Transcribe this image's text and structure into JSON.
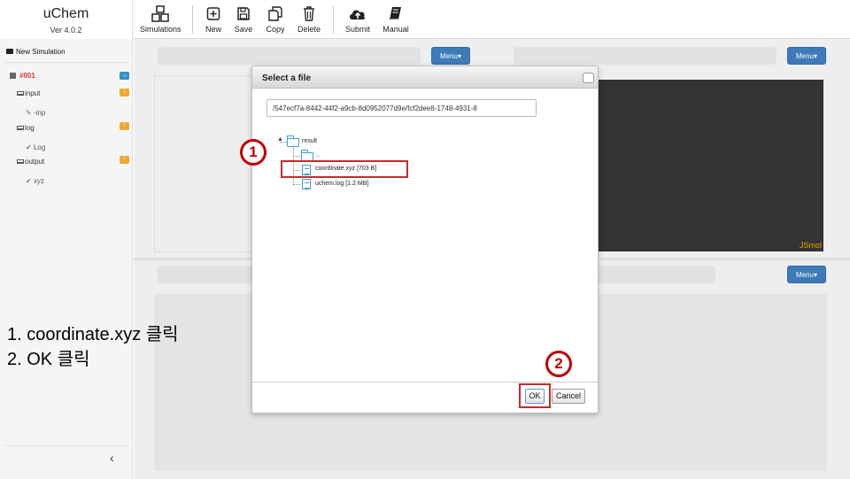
{
  "app": {
    "title": "uChem",
    "version": "Ver 4.0.2"
  },
  "toolbar": {
    "simulations": "Simulations",
    "new": "New",
    "save": "Save",
    "copy": "Copy",
    "delete": "Delete",
    "submit": "Submit",
    "manual": "Manual"
  },
  "sidebar": {
    "new_simulation": "New Simulation",
    "sim_id": "#001",
    "input_label": "input",
    "input_file": "-inp",
    "log_label": "log",
    "log_file": "Log",
    "output_label": "output",
    "output_file": "xyz",
    "badge_input": "!",
    "badge_log": "!",
    "badge_output": "!",
    "badge_sim": "→",
    "collapse": "‹"
  },
  "panels": {
    "menu_label": "Menu▾",
    "jsmol_label": "JSmol"
  },
  "dialog": {
    "title": "Select a file",
    "path_value": "/547ecf7a-8442-44f2-a9cb-8d0952077d9e/fcf2dee8-1748-4931-8",
    "tree": {
      "root": "result",
      "subfolder": "..",
      "file1": "coordinate.xyz [703 B]",
      "file2": "uchem.log [1.2 MB]"
    },
    "ok": "OK",
    "cancel": "Cancel"
  },
  "annotations": {
    "step1_marker": "1",
    "step2_marker": "2",
    "step1_text": "1. coordinate.xyz 클릭",
    "step2_text": "2. OK 클릭"
  },
  "colors": {
    "menu_button": "#3d7ab8",
    "annotation": "#c00000",
    "sim_label": "#d43a3a",
    "badge": "#f0a830"
  }
}
